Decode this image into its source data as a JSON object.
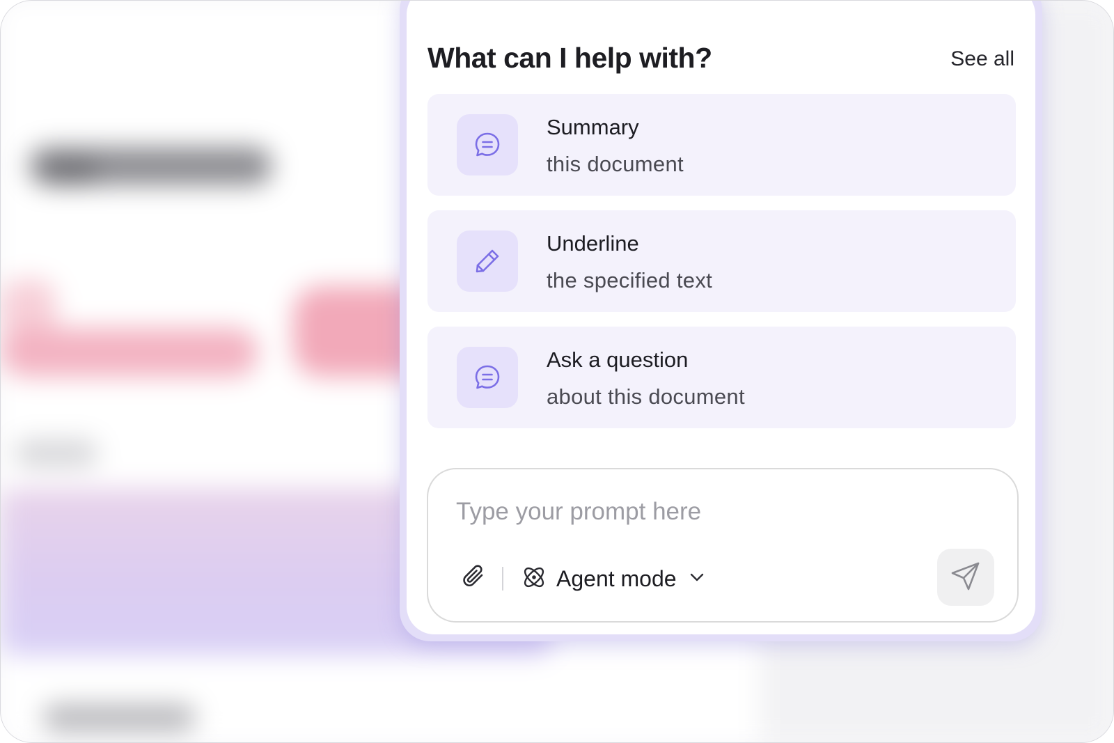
{
  "panel": {
    "title": "What can I help with?",
    "see_all_label": "See all"
  },
  "suggestions": [
    {
      "title": "Summary",
      "subtitle": "this document",
      "icon": "chat-bubble-icon"
    },
    {
      "title": "Underline",
      "subtitle": "the specified text",
      "icon": "pencil-icon"
    },
    {
      "title": "Ask a question",
      "subtitle": "about this document",
      "icon": "chat-bubble-icon"
    }
  ],
  "prompt": {
    "placeholder": "Type your prompt here",
    "value": "",
    "attach_icon": "paperclip-icon",
    "mode_label": "Agent mode",
    "mode_icon": "atom-icon",
    "mode_dropdown_icon": "chevron-down-icon",
    "send_icon": "send-icon"
  },
  "colors": {
    "accent": "#7b6ee6",
    "suggestion_bg": "#f4f2fc",
    "icon_tile_bg": "#e6e1fb"
  }
}
